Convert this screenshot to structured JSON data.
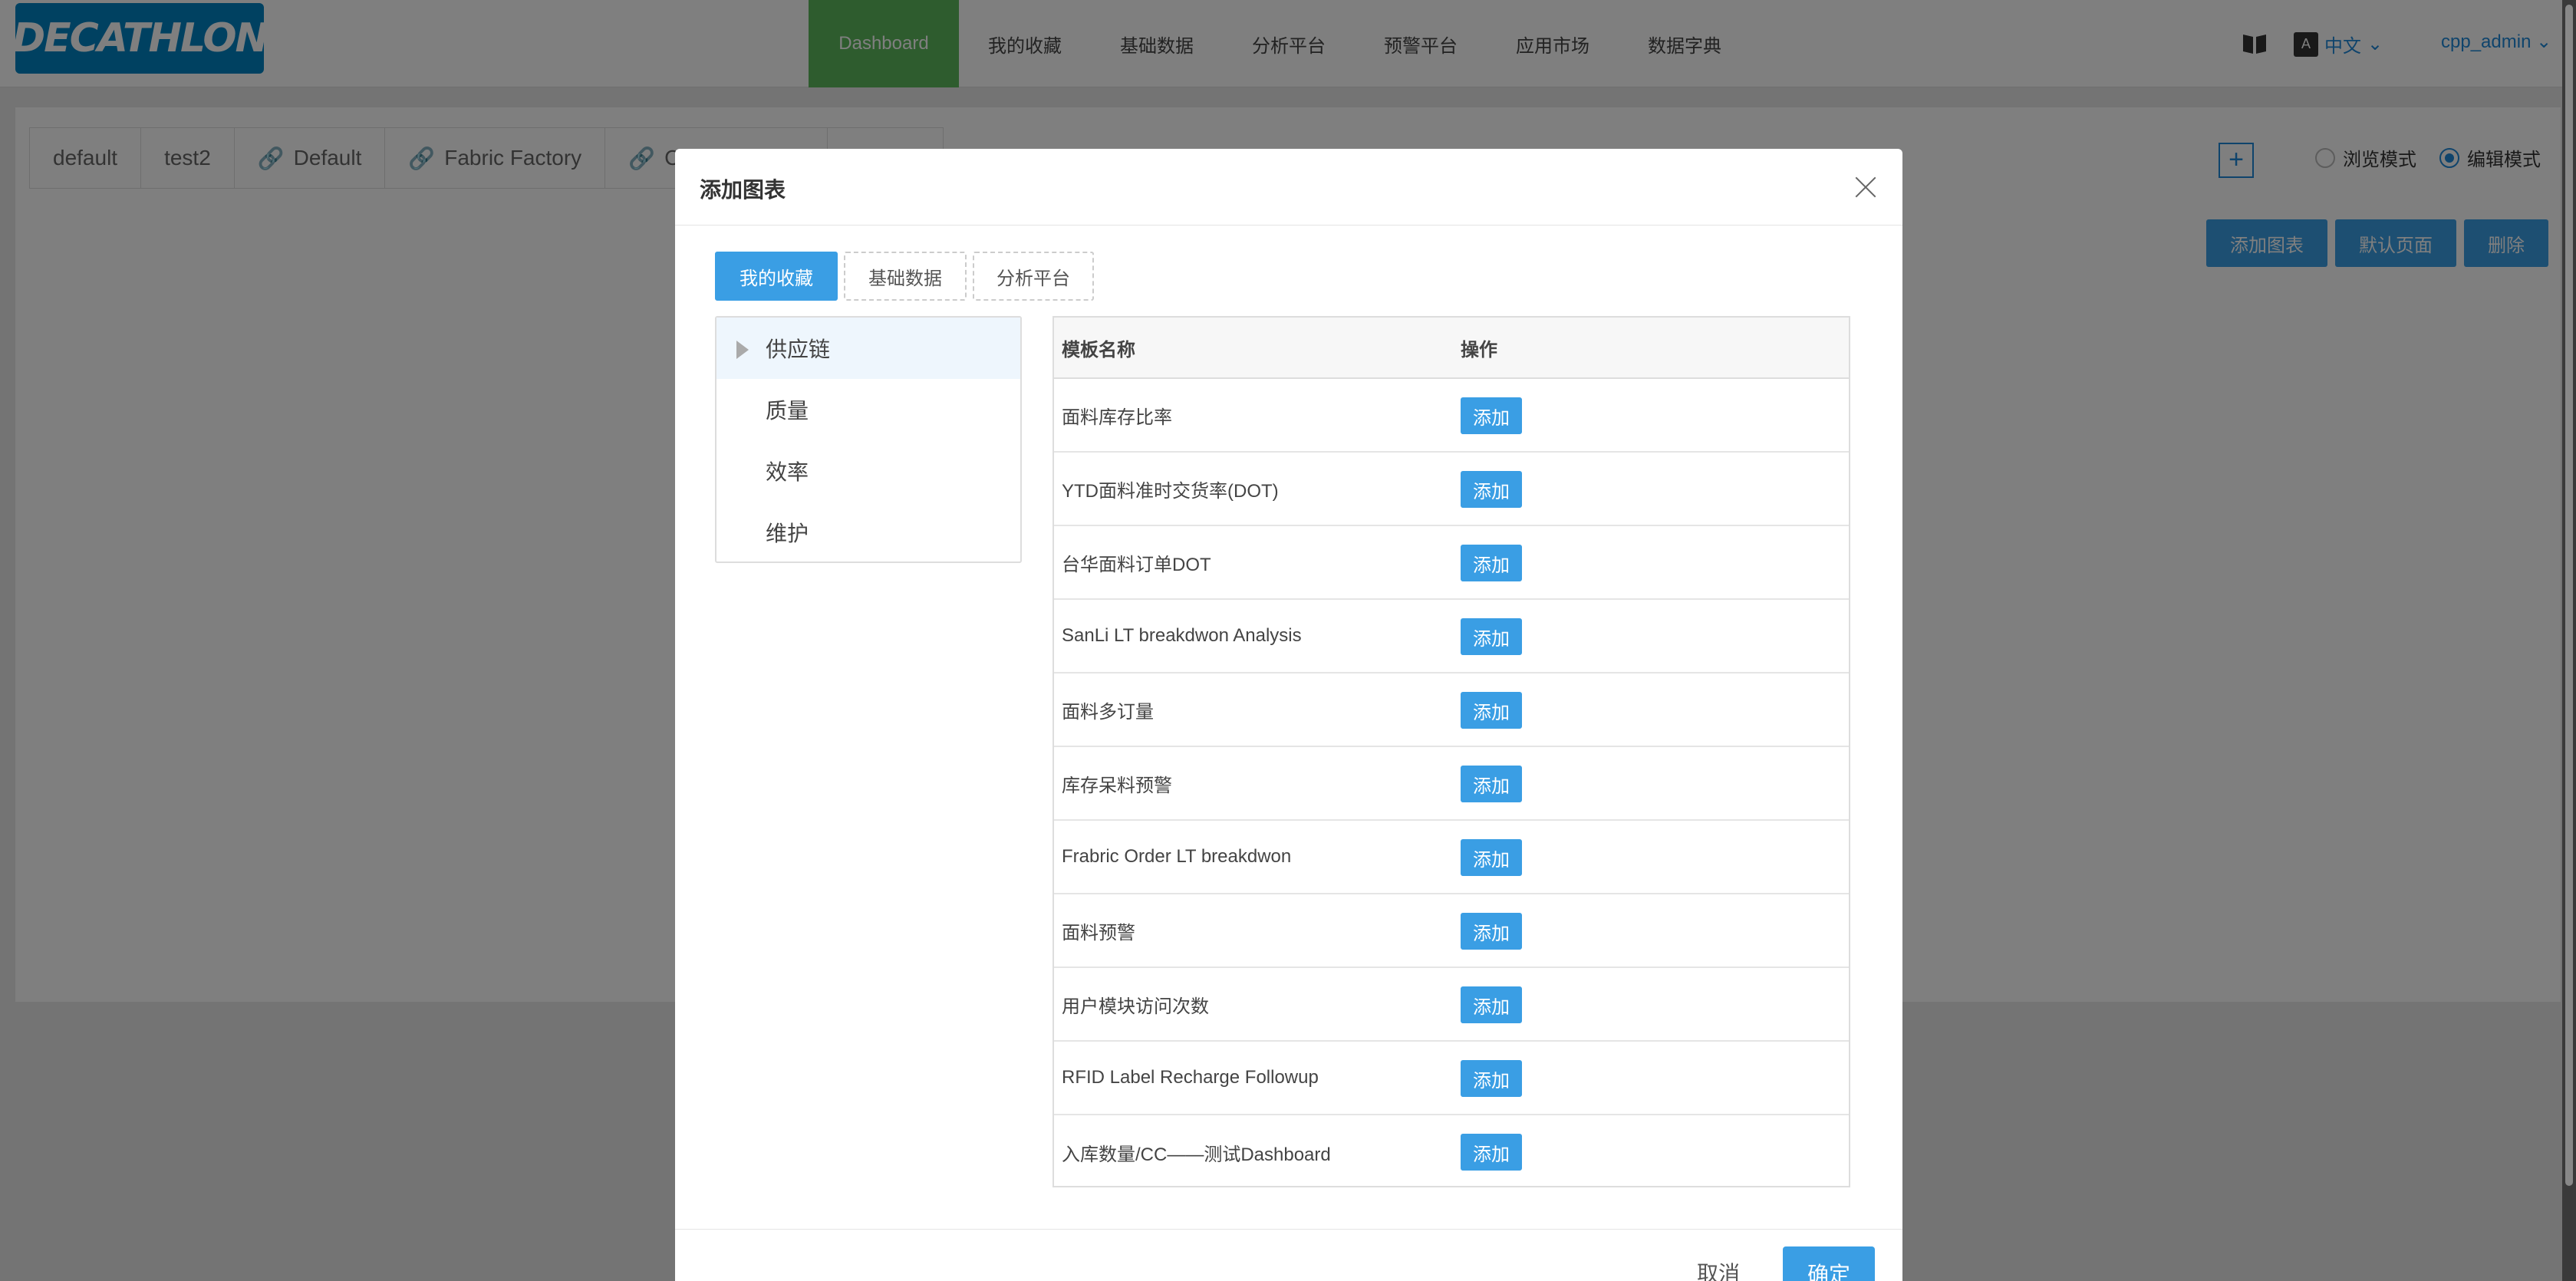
{
  "navbar": {
    "logo_text": "DECATHLON",
    "menu": [
      "Dashboard",
      "我的收藏",
      "基础数据",
      "分析平台",
      "预警平台",
      "应用市场",
      "数据字典"
    ],
    "active_index": 0,
    "book_icon": "book-icon",
    "language": {
      "badge": "A",
      "label": "中文"
    },
    "user": "cpp_admin"
  },
  "page": {
    "tabs": [
      "default",
      "test2",
      "Default",
      "Fabric Factory",
      "Clo"
    ],
    "modes": {
      "view": "浏览模式",
      "edit": "编辑模式",
      "selected": "edit"
    },
    "actions": {
      "add_chart": "添加图表",
      "default_page": "默认页面",
      "delete": "删除"
    }
  },
  "modal": {
    "title": "添加图表",
    "tabs": [
      "我的收藏",
      "基础数据",
      "分析平台"
    ],
    "active_tab": 0,
    "tree": [
      "供应链",
      "质量",
      "效率",
      "维护"
    ],
    "table": {
      "headers": {
        "name": "模板名称",
        "op": "操作"
      },
      "add_label": "添加",
      "rows": [
        "面料库存比率",
        "YTD面料准时交货率(DOT)",
        "台华面料订单DOT",
        "SanLi LT breakdwon Analysis",
        "面料多订量",
        "库存呆料预警",
        "Frabric Order LT breakdwon",
        "面料预警",
        "用户模块访问次数",
        "RFID Label Recharge Followup",
        "入库数量/CC——测试Dashboard"
      ]
    },
    "footer": {
      "cancel": "取消",
      "ok": "确定"
    }
  },
  "colors": {
    "primary": "#3a9ee4",
    "nav_active": "#5cb85c",
    "brand": "#0082c3"
  }
}
